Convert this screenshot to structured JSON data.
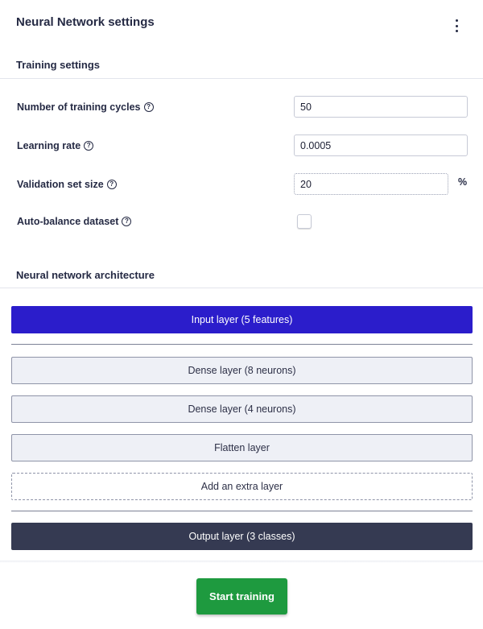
{
  "header": {
    "title": "Neural Network settings",
    "menu_icon": "more-vertical-icon"
  },
  "training": {
    "title": "Training settings",
    "fields": {
      "cycles": {
        "label": "Number of training cycles",
        "value": "50"
      },
      "learning_rate": {
        "label": "Learning rate",
        "value": "0.0005"
      },
      "validation": {
        "label": "Validation set size",
        "value": "20",
        "unit": "%"
      },
      "auto_balance": {
        "label": "Auto-balance dataset",
        "checked": false
      }
    },
    "help_icon": "help-circle-icon",
    "help_glyph": "?"
  },
  "architecture": {
    "title": "Neural network architecture",
    "input_layer": "Input layer (5 features)",
    "layers": [
      "Dense layer (8 neurons)",
      "Dense layer (4 neurons)",
      "Flatten layer"
    ],
    "add_layer": "Add an extra layer",
    "output_layer": "Output layer (3 classes)"
  },
  "footer": {
    "start_button": "Start training"
  },
  "colors": {
    "input_layer": "#2b1dcb",
    "output_layer": "#353a52",
    "primary_button": "#1e9a3f"
  }
}
